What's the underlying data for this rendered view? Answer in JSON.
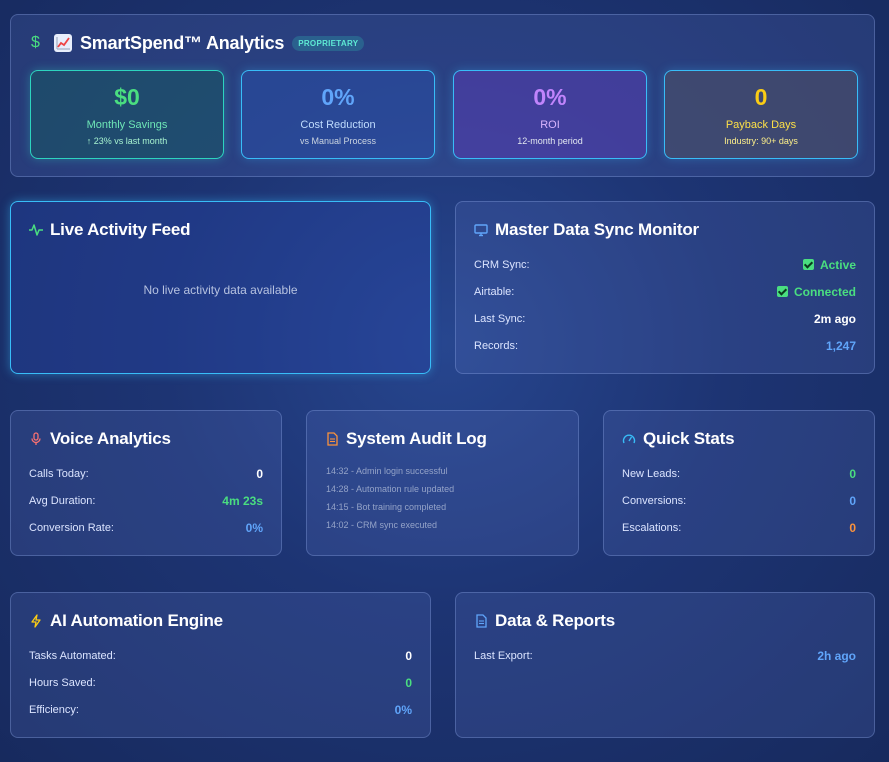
{
  "header": {
    "dollar_icon": "$",
    "title": "SmartSpend™ Analytics",
    "badge": "PROPRIETARY",
    "kpis": [
      {
        "value": "$0",
        "label": "Monthly Savings",
        "sub": "↑ 23% vs last month"
      },
      {
        "value": "0%",
        "label": "Cost Reduction",
        "sub": "vs Manual Process"
      },
      {
        "value": "0%",
        "label": "ROI",
        "sub": "12-month period"
      },
      {
        "value": "0",
        "label": "Payback Days",
        "sub": "Industry: 90+ days"
      }
    ]
  },
  "live_feed": {
    "title": "Live Activity Feed",
    "empty_text": "No live activity data available"
  },
  "sync_monitor": {
    "title": "Master Data Sync Monitor",
    "rows": [
      {
        "label": "CRM Sync:",
        "value": "Active"
      },
      {
        "label": "Airtable:",
        "value": "Connected"
      },
      {
        "label": "Last Sync:",
        "value": "2m ago"
      },
      {
        "label": "Records:",
        "value": "1,247"
      }
    ]
  },
  "voice": {
    "title": "Voice Analytics",
    "rows": [
      {
        "label": "Calls Today:",
        "value": "0"
      },
      {
        "label": "Avg Duration:",
        "value": "4m 23s"
      },
      {
        "label": "Conversion Rate:",
        "value": "0%"
      }
    ]
  },
  "audit": {
    "title": "System Audit Log",
    "entries": [
      "14:32 - Admin login successful",
      "14:28 - Automation rule updated",
      "14:15 - Bot training completed",
      "14:02 - CRM sync executed"
    ]
  },
  "quick_stats": {
    "title": "Quick Stats",
    "rows": [
      {
        "label": "New Leads:",
        "value": "0"
      },
      {
        "label": "Conversions:",
        "value": "0"
      },
      {
        "label": "Escalations:",
        "value": "0"
      }
    ]
  },
  "ai_engine": {
    "title": "AI Automation Engine",
    "rows": [
      {
        "label": "Tasks Automated:",
        "value": "0"
      },
      {
        "label": "Hours Saved:",
        "value": "0"
      },
      {
        "label": "Efficiency:",
        "value": "0%"
      }
    ]
  },
  "reports": {
    "title": "Data & Reports",
    "rows": [
      {
        "label": "Last Export:",
        "value": "2h ago"
      }
    ]
  },
  "colors": {
    "green": "#4ade80",
    "blue": "#60a5fa",
    "orange": "#fb923c",
    "cyan_border": "#38bdf8"
  }
}
